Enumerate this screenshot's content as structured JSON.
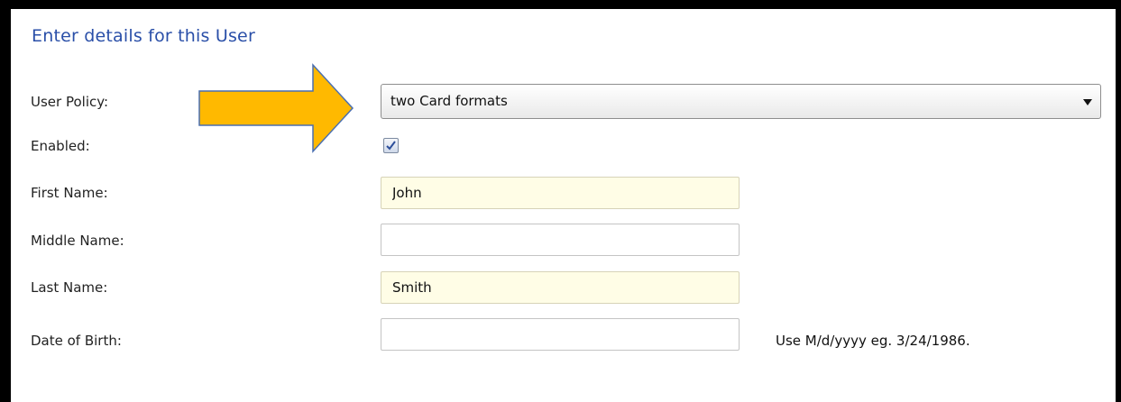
{
  "form": {
    "heading": "Enter details for this User",
    "user_policy": {
      "label": "User Policy:",
      "value": "two Card formats"
    },
    "enabled": {
      "label": "Enabled:",
      "checked": true
    },
    "first_name": {
      "label": "First Name:",
      "value": "John"
    },
    "middle_name": {
      "label": "Middle Name:",
      "value": ""
    },
    "last_name": {
      "label": "Last Name:",
      "value": "Smith"
    },
    "date_of_birth": {
      "label": "Date of Birth:",
      "value": "",
      "hint": "Use M/d/yyyy eg. 3/24/1986."
    }
  },
  "callout": {
    "icon": "arrow-right-icon",
    "color": "#ffb900",
    "stroke": "#4a6fb0"
  },
  "colors": {
    "heading": "#2a4fa8",
    "required_field_bg": "#fffde6"
  }
}
